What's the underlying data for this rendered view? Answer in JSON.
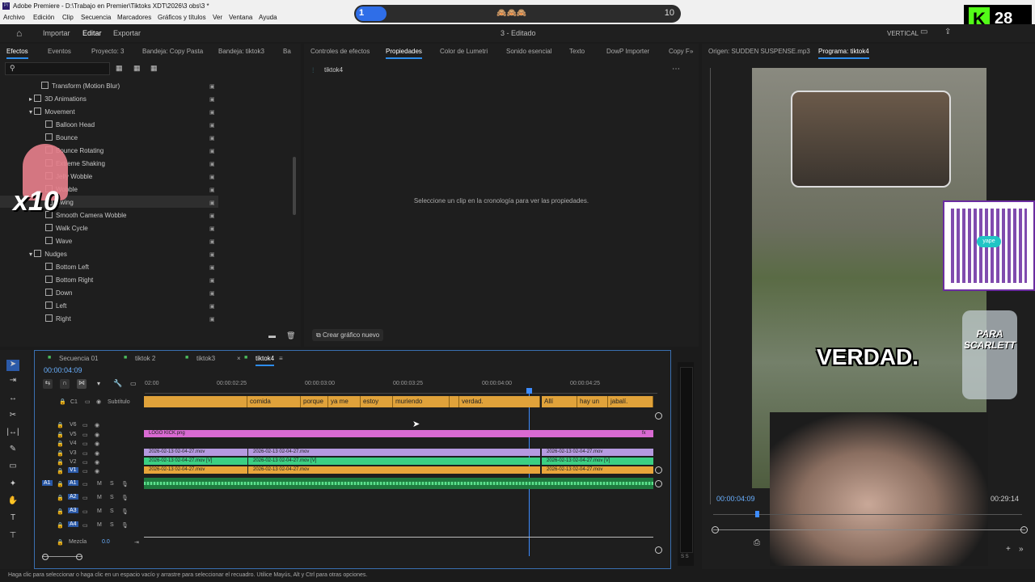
{
  "window": {
    "title": "Adobe Premiere - D:\\Trabajo en Premier\\Tiktoks XDT\\2026\\3 obs\\3 *"
  },
  "menu": [
    "Archivo",
    "Edición",
    "Clip",
    "Secuencia",
    "Marcadores",
    "Gráficos y títulos",
    "Ver",
    "Ventana",
    "Ayuda"
  ],
  "overlay": {
    "progress_start": "1",
    "progress_end": "10",
    "progress_fraction": 0.1,
    "emojis": "🙈🙈🙈",
    "kick_count": "28",
    "kick_letter": "K"
  },
  "header": {
    "home": "home-icon",
    "import": "Importar",
    "edit": "Editar",
    "export": "Exportar",
    "project": "3 - Editado",
    "layout": "VERTICAL"
  },
  "effects_panel": {
    "tabs": [
      "Efectos",
      "Eventos",
      "Proyecto: 3",
      "Bandeja: Copy Pasta",
      "Bandeja: tiktok3",
      "Ba"
    ],
    "items": [
      {
        "label": "Transform (Motion Blur)"
      },
      {
        "label": "3D Animations"
      },
      {
        "label": "Movement"
      },
      {
        "label": "Balloon Head"
      },
      {
        "label": "Bounce"
      },
      {
        "label": "Bounce Rotating"
      },
      {
        "label": "Extreme Shaking"
      },
      {
        "label": "Jelly Wobble"
      },
      {
        "label": "Wobble"
      },
      {
        "label": "Swing"
      },
      {
        "label": "Smooth Camera Wobble"
      },
      {
        "label": "Walk Cycle"
      },
      {
        "label": "Wave"
      },
      {
        "label": "Nudges"
      },
      {
        "label": "Bottom Left"
      },
      {
        "label": "Bottom Right"
      },
      {
        "label": "Down"
      },
      {
        "label": "Left"
      },
      {
        "label": "Right"
      }
    ],
    "sticker_text": "x10"
  },
  "properties_panel": {
    "tabs": [
      "Controles de efectos",
      "Propiedades",
      "Color de Lumetri",
      "Sonido esencial",
      "Texto",
      "DowP Importer",
      "Copy F"
    ],
    "sequence": "tiktok4",
    "empty_message": "Seleccione un clip en la cronología para ver las propiedades.",
    "new_graphic": "Crear gráfico nuevo"
  },
  "monitor": {
    "tabs": [
      "Origen: SUDDEN SUSPENSE.mp3",
      "Programa: tiktok4"
    ],
    "caption": "VERDAD.",
    "jar_text": "PARA SCARLETT",
    "timecode_left": "00:00:04:09",
    "timecode_right": "00:29:14",
    "qr_label": "yape"
  },
  "timeline": {
    "tabs": [
      "Secuencia 01",
      "tiktok 2",
      "tiktok3",
      "tiktok4"
    ],
    "timecode": "00:00:04:09",
    "ruler": [
      "02:00",
      "00:00:02:25",
      "00:00:03:00",
      "00:00:03:25",
      "00:00:04:00",
      "00:00:04:25"
    ],
    "subtitle_track": "Subtítulo",
    "subtitle_label": "C1",
    "subtitles": [
      "comida",
      "porque",
      "ya me",
      "estoy",
      "muriendo",
      "verdad.",
      "Allí",
      "hay un",
      "jabalí."
    ],
    "video_tracks": [
      "V6",
      "V5",
      "V4",
      "V3",
      "V2",
      "V1"
    ],
    "audio_tracks": [
      "A1",
      "A2",
      "A3",
      "A4"
    ],
    "logo_clip": "LOGO KICK.png",
    "mov_clip": "2026-02-13 02-04-27.mov",
    "mov_clip_v": "2026-02-13 02-04-27.mov [V]",
    "fx": "fx",
    "mix_label": "Mezcla",
    "mix_value": "0.0",
    "m": "M",
    "s": "S",
    "ss": "S S"
  },
  "status": "Haga clic para seleccionar o haga clic en un espacio vacío y arrastre para seleccionar el recuadro. Utilice Mayús, Alt y Ctrl para otras opciones."
}
